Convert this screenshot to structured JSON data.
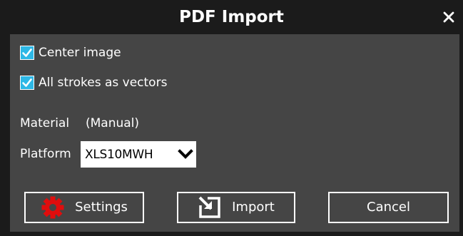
{
  "window": {
    "title": "PDF Import",
    "close_icon": "close-icon"
  },
  "options": {
    "center_image": {
      "label": "Center image",
      "checked": true
    },
    "all_strokes": {
      "label": "All strokes as vectors",
      "checked": true
    }
  },
  "material": {
    "label": "Material",
    "mode": "(Manual)"
  },
  "platform": {
    "label": "Platform",
    "selected": "XLS10MWH",
    "icon": "chevron-down-icon"
  },
  "buttons": {
    "settings_label": "Settings",
    "settings_icon": "gear-icon",
    "import_label": "Import",
    "import_icon": "import-icon",
    "cancel_label": "Cancel"
  },
  "colors": {
    "title_bar": "#1b1b1b",
    "panel": "#454545",
    "checkbox_accent": "#2eb8e6",
    "gear_red": "#e00d0d",
    "text": "#ffffff"
  }
}
